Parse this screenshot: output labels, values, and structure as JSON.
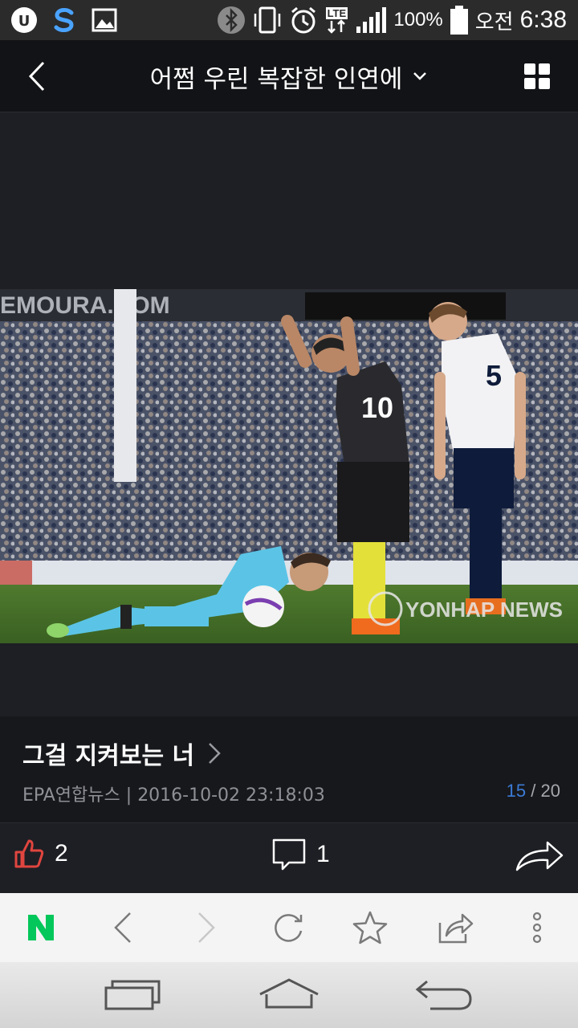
{
  "status_bar": {
    "battery": "100%",
    "time_period": "오전",
    "time": "6:38",
    "network": "LTE"
  },
  "header": {
    "title": "어쩜 우린 복잡한 인연에"
  },
  "photo": {
    "watermark": "YONHAP NEWS",
    "player_number_1": "10",
    "player_number_2": "5",
    "banner_text": "EMOURA.COM"
  },
  "caption": {
    "title": "그걸 지켜보는 너",
    "source": "EPA연합뉴스",
    "datetime": "2016-10-02 23:18:03",
    "current_page": "15",
    "total_pages": "20"
  },
  "actions": {
    "likes": "2",
    "comments": "1"
  },
  "colors": {
    "accent_blue": "#3b7bd6",
    "like_red": "#e0453f",
    "naver_green": "#03c75a"
  }
}
